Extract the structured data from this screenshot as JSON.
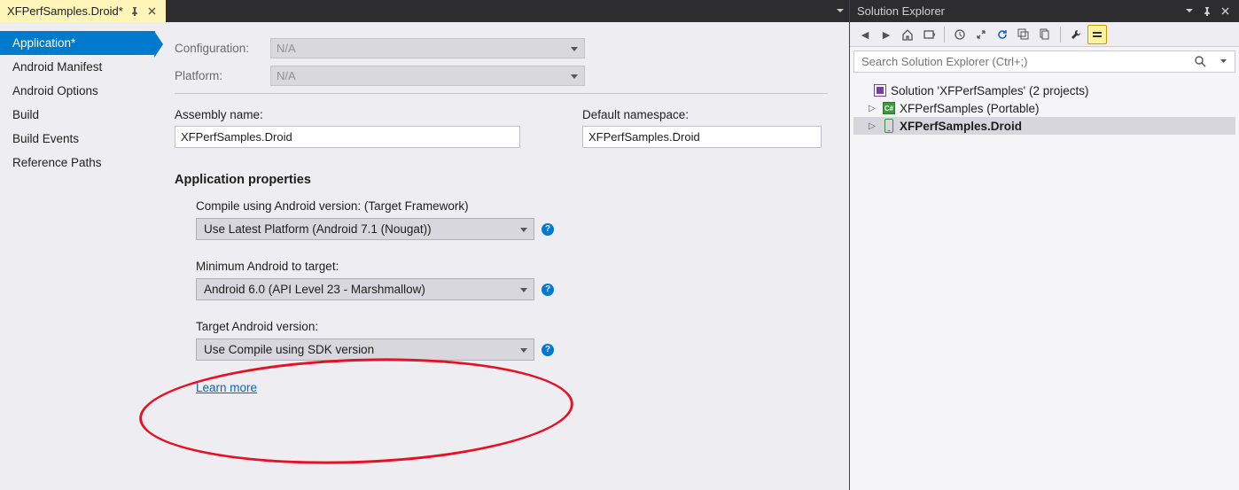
{
  "tab": {
    "title": "XFPerfSamples.Droid*"
  },
  "sidenav": {
    "items": [
      {
        "label": "Application*",
        "active": true
      },
      {
        "label": "Android Manifest"
      },
      {
        "label": "Android Options"
      },
      {
        "label": "Build"
      },
      {
        "label": "Build Events"
      },
      {
        "label": "Reference Paths"
      }
    ]
  },
  "config": {
    "configuration_label": "Configuration:",
    "configuration_value": "N/A",
    "platform_label": "Platform:",
    "platform_value": "N/A"
  },
  "fields": {
    "assembly_name_label": "Assembly name:",
    "assembly_name_value": "XFPerfSamples.Droid",
    "default_ns_label": "Default namespace:",
    "default_ns_value": "XFPerfSamples.Droid"
  },
  "app_props": {
    "title": "Application properties",
    "compile_label": "Compile using Android version:  (Target Framework)",
    "compile_value": "Use Latest Platform (Android 7.1 (Nougat))",
    "min_label": "Minimum Android to target:",
    "min_value": "Android 6.0 (API Level 23 - Marshmallow)",
    "target_label": "Target Android version:",
    "target_value": "Use Compile using SDK version",
    "learn_more": "Learn more"
  },
  "solution_explorer": {
    "title": "Solution Explorer",
    "search_placeholder": "Search Solution Explorer (Ctrl+;)",
    "tree": {
      "root": "Solution 'XFPerfSamples' (2 projects)",
      "items": [
        {
          "label": "XFPerfSamples (Portable)",
          "icon": "csharp",
          "bold": false
        },
        {
          "label": "XFPerfSamples.Droid",
          "icon": "phone",
          "bold": true,
          "selected": true
        }
      ]
    }
  }
}
